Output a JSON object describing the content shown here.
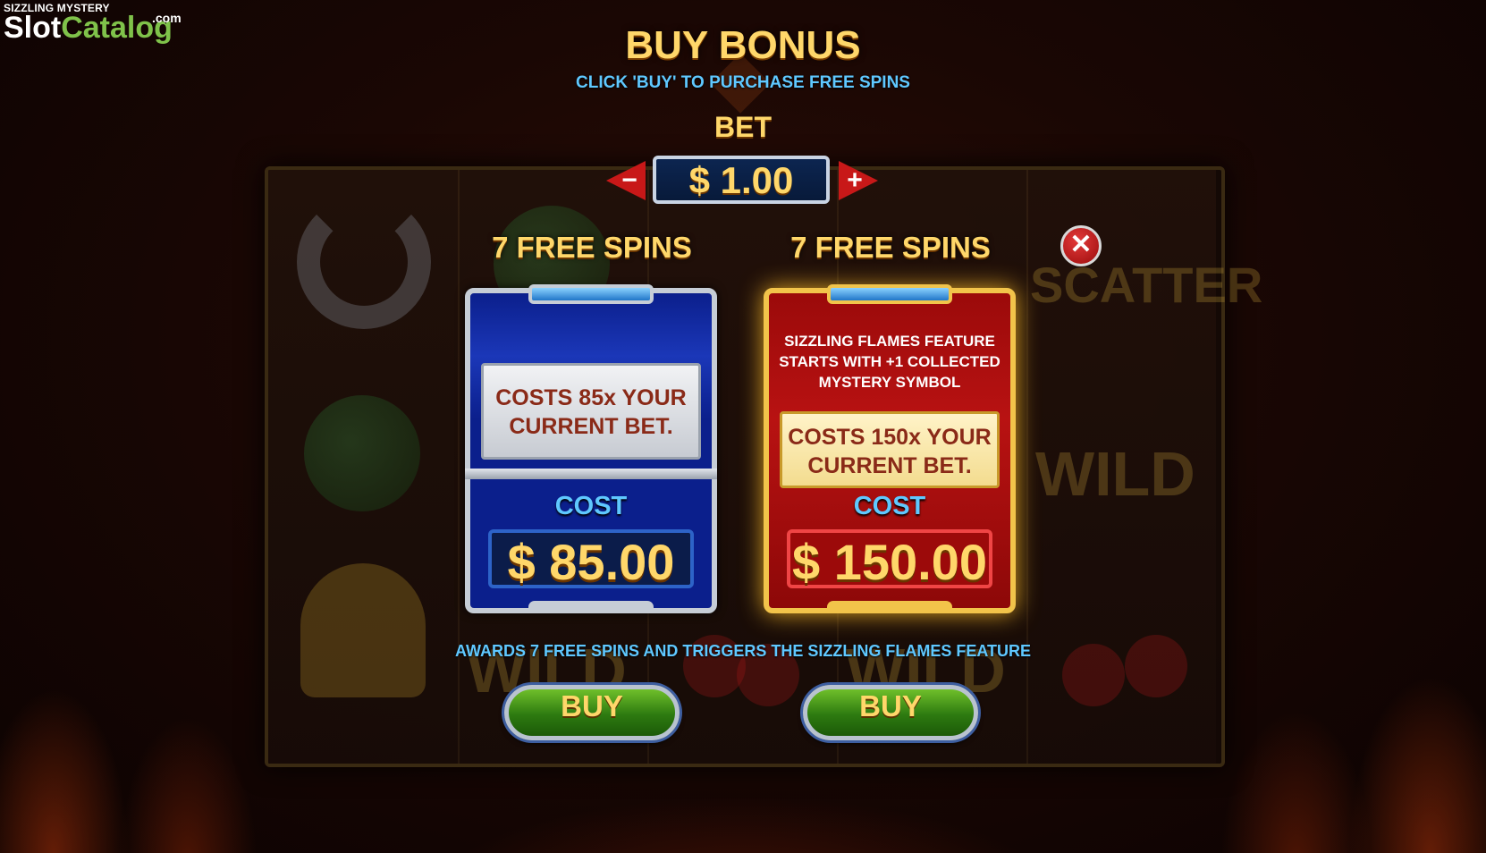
{
  "watermark": {
    "top": "SIZZLING MYSTERY",
    "slot": "Slot",
    "catalog": "Catalog",
    "com": ".com"
  },
  "header": {
    "title": "BUY BONUS",
    "subtitle": "CLICK 'BUY' TO PURCHASE FREE SPINS"
  },
  "bet": {
    "label": "BET",
    "value": "$ 1.00",
    "decrease_symbol": "−",
    "increase_symbol": "+"
  },
  "close": {
    "symbol": "✕"
  },
  "options": [
    {
      "title": "7 FREE SPINS",
      "feature": "",
      "cost_text": "COSTS 85x YOUR CURRENT BET.",
      "cost_label": "COST",
      "price": "$ 85.00",
      "buy_label": "BUY",
      "theme": "#1b37b8"
    },
    {
      "title": "7 FREE SPINS",
      "feature": "SIZZLING FLAMES FEATURE STARTS WITH +1 COLLECTED MYSTERY SYMBOL",
      "cost_text": "COSTS 150x YOUR CURRENT BET.",
      "cost_label": "COST",
      "price": "$ 150.00",
      "buy_label": "BUY",
      "theme": "#b81212"
    }
  ],
  "awards_text": "AWARDS 7 FREE SPINS AND TRIGGERS THE SIZZLING FLAMES FEATURE",
  "background_symbols": {
    "scatter": "SCATTER",
    "wild": "WILD"
  }
}
